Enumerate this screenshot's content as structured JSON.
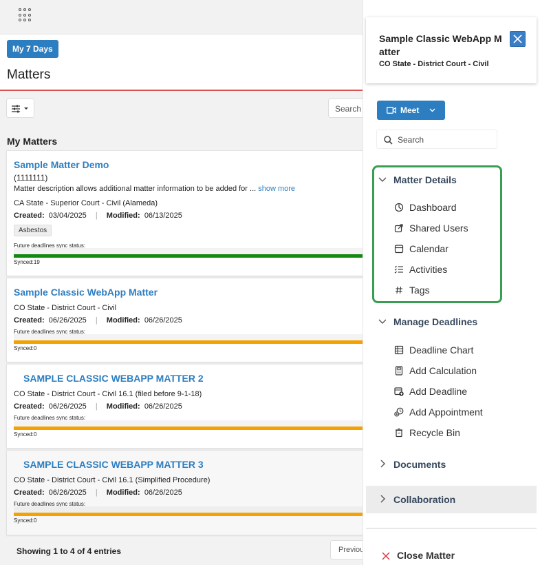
{
  "header": {
    "my7_label": "My 7 Days",
    "page_title": "Matters",
    "search_label": "Search"
  },
  "section_label": "My Matters",
  "matters": [
    {
      "title": "Sample Matter Demo",
      "number": "(1111111)",
      "description": "Matter description allows additional matter information to be added for ...",
      "show_more": "show more",
      "court": "CA State - Superior Court - Civil (Alameda)",
      "created_label": "Created:",
      "created": "03/04/2025",
      "modified_label": "Modified:",
      "modified": "06/13/2025",
      "tag": "Asbestos",
      "sync_label": "Future deadlines sync status:",
      "synced": "Synced:19",
      "sync_color": "#128a12"
    },
    {
      "title": "Sample Classic WebApp Matter",
      "court": "CO State - District Court - Civil",
      "created_label": "Created:",
      "created": "06/26/2025",
      "modified_label": "Modified:",
      "modified": "06/26/2025",
      "sync_label": "Future deadlines sync status:",
      "synced": "Synced:0",
      "sync_color": "#f5a100"
    },
    {
      "title": "SAMPLE CLASSIC WEBAPP MATTER 2",
      "court": "CO State - District Court - Civil 16.1 (filed before 9-1-18)",
      "created_label": "Created:",
      "created": "06/26/2025",
      "modified_label": "Modified:",
      "modified": "06/26/2025",
      "sync_label": "Future deadlines sync status:",
      "synced": "Synced:0",
      "sync_color": "#f5a100"
    },
    {
      "title": "SAMPLE CLASSIC WEBAPP MATTER 3",
      "court": "CO State - District Court - Civil 16.1 (Simplified Procedure)",
      "created_label": "Created:",
      "created": "06/26/2025",
      "modified_label": "Modified:",
      "modified": "06/26/2025",
      "sync_label": "Future deadlines sync status:",
      "synced": "Synced:0",
      "sync_color": "#f5a100"
    }
  ],
  "footer": {
    "showing": "Showing 1 to 4 of 4 entries",
    "previous": "Previous"
  },
  "panel": {
    "title": "Sample Classic WebApp Matter",
    "subtitle": "CO State - District Court - Civil",
    "meet_label": "Meet",
    "search_placeholder": "Search",
    "matter_details": {
      "label": "Matter Details",
      "items": [
        "Dashboard",
        "Shared Users",
        "Calendar",
        "Activities",
        "Tags"
      ]
    },
    "manage_deadlines": {
      "label": "Manage Deadlines",
      "items": [
        "Deadline Chart",
        "Add Calculation",
        "Add Deadline",
        "Add Appointment",
        "Recycle Bin"
      ]
    },
    "documents_label": "Documents",
    "collaboration_label": "Collaboration",
    "close_matter": "Close Matter",
    "accent_color": "#2d7ec0",
    "highlight_color": "#3a9e52"
  }
}
